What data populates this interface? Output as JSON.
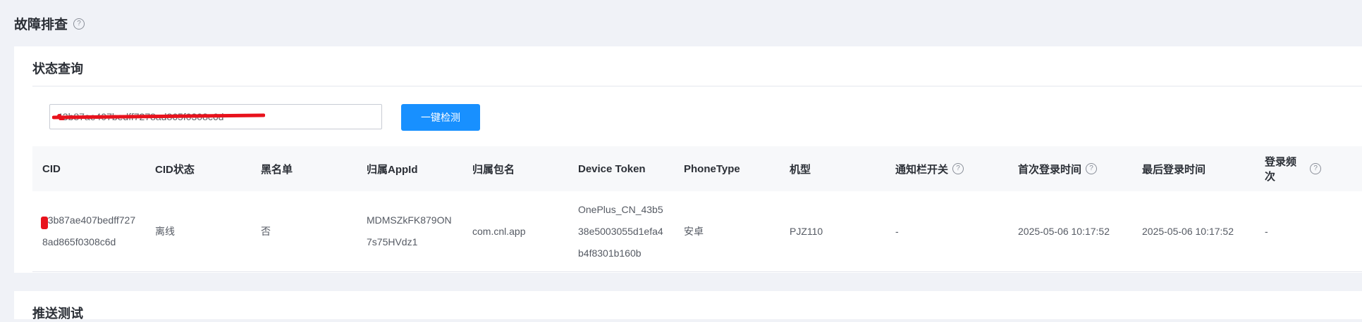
{
  "page": {
    "title": "故障排查"
  },
  "status_query": {
    "title": "状态查询",
    "input_value": "43b87ae407bedff7278ad865f0308c6d",
    "button_label": "一键检测"
  },
  "table": {
    "headers": [
      {
        "label": "CID",
        "help": false
      },
      {
        "label": "CID状态",
        "help": false
      },
      {
        "label": "黑名单",
        "help": false
      },
      {
        "label": "归属AppId",
        "help": false
      },
      {
        "label": "归属包名",
        "help": false
      },
      {
        "label": "Device Token",
        "help": false
      },
      {
        "label": "PhoneType",
        "help": false
      },
      {
        "label": "机型",
        "help": false
      },
      {
        "label": "通知栏开关",
        "help": true
      },
      {
        "label": "首次登录时间",
        "help": true
      },
      {
        "label": "最后登录时间",
        "help": false
      },
      {
        "label": "登录频次",
        "help": true
      }
    ],
    "rows": [
      {
        "cid": "43b87ae407bedff7278ad865f0308c6d",
        "cid_status": "离线",
        "blacklist": "否",
        "app_id": "MDMSZkFK879ON7s75HVdz1",
        "package": "com.cnl.app",
        "device_token": "OnePlus_CN_43b538e5003055d1efa4b4f8301b160b",
        "phone_type": "安卓",
        "model": "PJZ110",
        "notification_switch": "-",
        "first_login": "2025-05-06 10:17:52",
        "last_login": "2025-05-06 10:17:52",
        "login_frequency": "-"
      }
    ]
  },
  "push_test": {
    "title": "推送测试"
  },
  "icons": {
    "help": "question-circle-icon"
  },
  "colors": {
    "primary": "#1890ff",
    "redaction": "#e8121c"
  }
}
